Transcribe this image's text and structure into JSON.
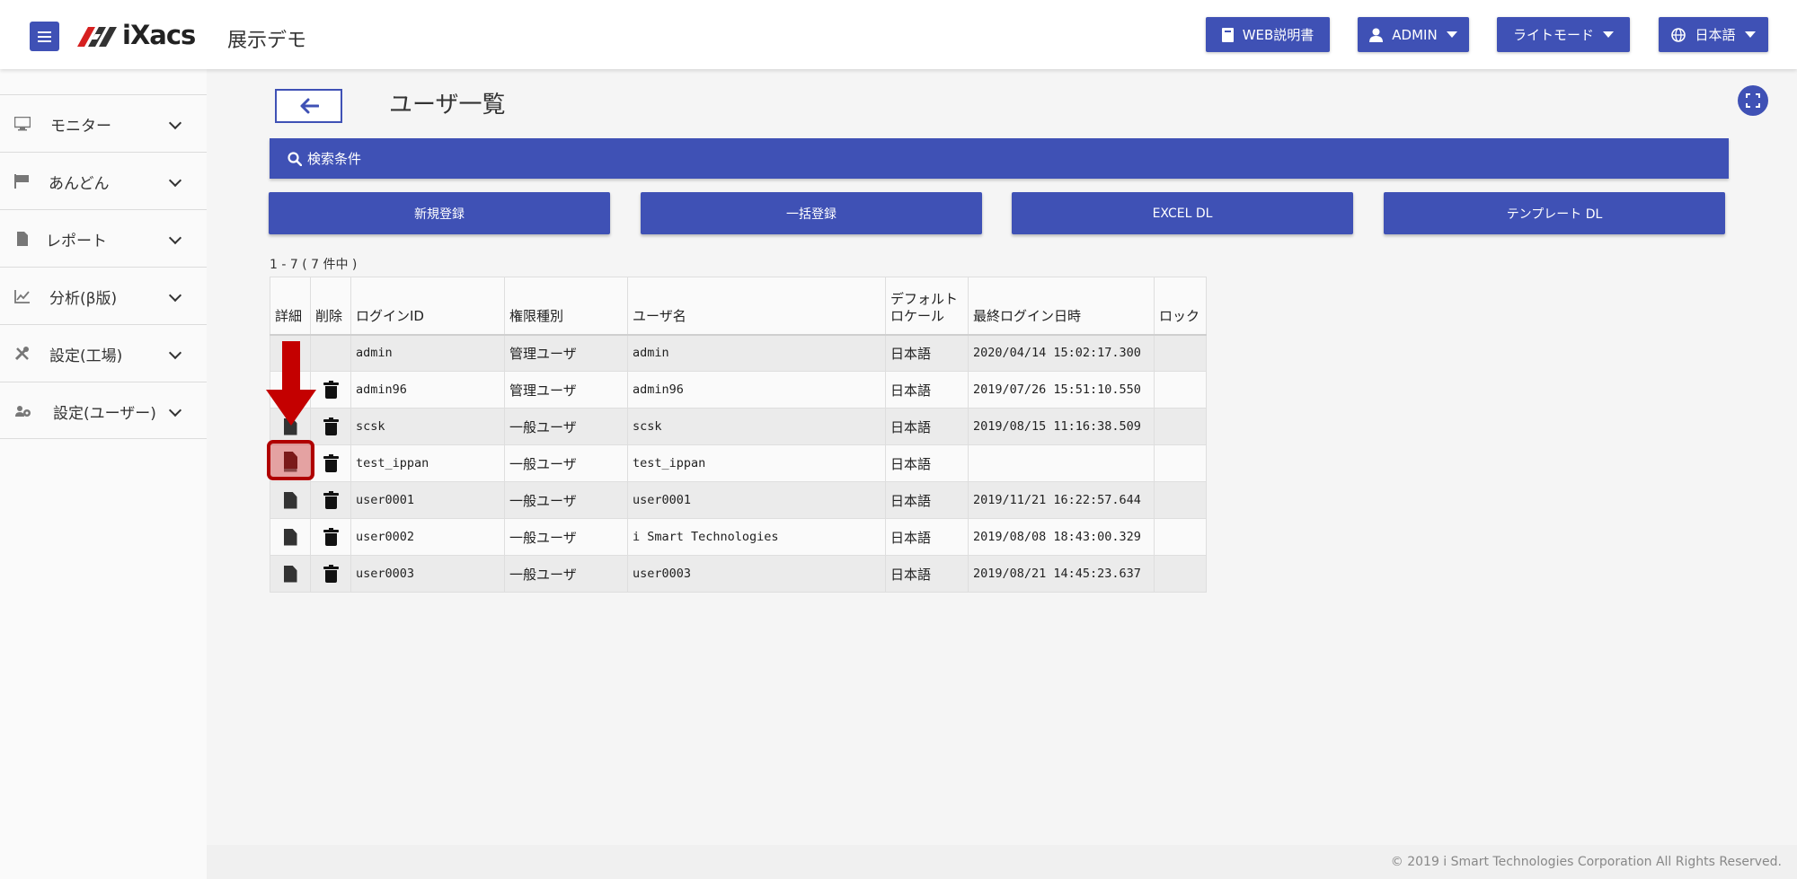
{
  "header": {
    "brand": "iXacs",
    "app_title": "展示デモ",
    "buttons": {
      "manual": "WEB説明書",
      "user": "ADMIN",
      "theme": "ライトモード",
      "language": "日本語"
    }
  },
  "sidebar": {
    "items": [
      {
        "label": "モニター",
        "icon": "monitor-icon"
      },
      {
        "label": "あんどん",
        "icon": "flag-icon"
      },
      {
        "label": "レポート",
        "icon": "file-icon"
      },
      {
        "label": "分析(β版)",
        "icon": "chart-line-icon"
      },
      {
        "label": "設定(工場)",
        "icon": "tools-icon"
      },
      {
        "label": "設定(ユーザー)",
        "icon": "users-cog-icon"
      }
    ]
  },
  "page": {
    "title": "ユーザ一覧",
    "search_label": "検索条件",
    "actions": {
      "new": "新規登録",
      "bulk": "一括登録",
      "excel": "EXCEL DL",
      "template": "テンプレート DL"
    },
    "count": "1 - 7 ( 7 件中 )"
  },
  "table": {
    "headers": {
      "detail": "詳細",
      "delete": "削除",
      "login_id": "ログインID",
      "role": "権限種別",
      "user_name": "ユーザ名",
      "locale_1": "デフォルト",
      "locale_2": "ロケール",
      "last_login": "最終ログイン日時",
      "lock": "ロック"
    },
    "rows": [
      {
        "login_id": "admin",
        "role": "管理ユーザ",
        "user_name": "admin",
        "locale": "日本語",
        "last_login": "2020/04/14 15:02:17.300",
        "lock": ""
      },
      {
        "login_id": "admin96",
        "role": "管理ユーザ",
        "user_name": "admin96",
        "locale": "日本語",
        "last_login": "2019/07/26 15:51:10.550",
        "lock": ""
      },
      {
        "login_id": "scsk",
        "role": "一般ユーザ",
        "user_name": "scsk",
        "locale": "日本語",
        "last_login": "2019/08/15 11:16:38.509",
        "lock": ""
      },
      {
        "login_id": "test_ippan",
        "role": "一般ユーザ",
        "user_name": "test_ippan",
        "locale": "日本語",
        "last_login": "",
        "lock": ""
      },
      {
        "login_id": "user0001",
        "role": "一般ユーザ",
        "user_name": "user0001",
        "locale": "日本語",
        "last_login": "2019/11/21 16:22:57.644",
        "lock": ""
      },
      {
        "login_id": "user0002",
        "role": "一般ユーザ",
        "user_name": "i Smart Technologies",
        "locale": "日本語",
        "last_login": "2019/08/08 18:43:00.329",
        "lock": ""
      },
      {
        "login_id": "user0003",
        "role": "一般ユーザ",
        "user_name": "user0003",
        "locale": "日本語",
        "last_login": "2019/08/21 14:45:23.637",
        "lock": ""
      }
    ]
  },
  "footer": {
    "copyright": "© 2019 i Smart Technologies Corporation All Rights Reserved."
  },
  "colors": {
    "primary": "#3f51b5",
    "annotation": "#b00000"
  }
}
